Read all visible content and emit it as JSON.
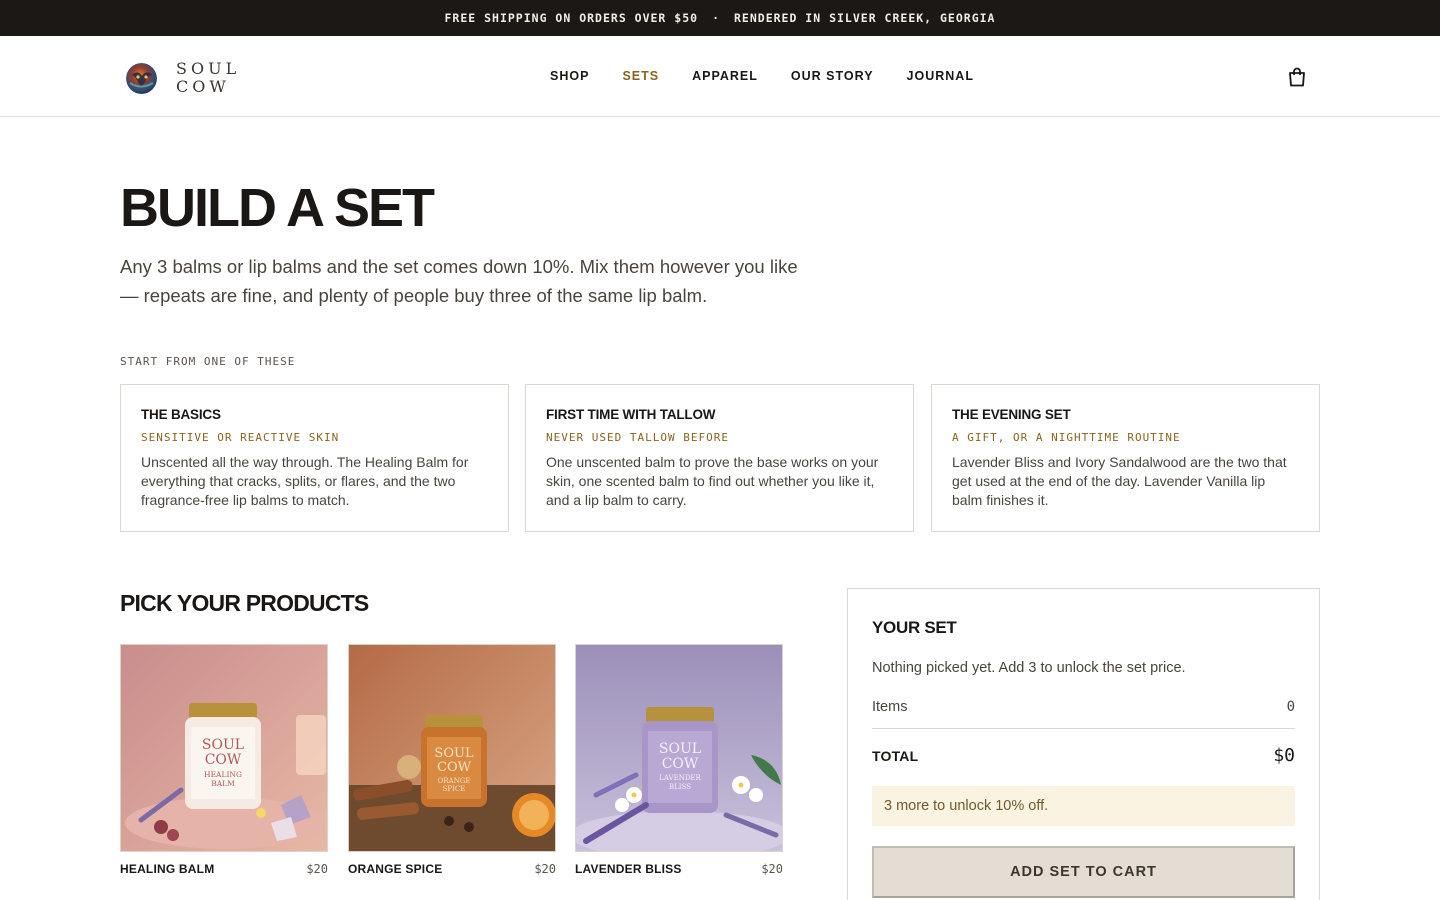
{
  "announcement": {
    "left": "FREE SHIPPING ON ORDERS OVER $50",
    "separator": "·",
    "right": "RENDERED IN SILVER CREEK, GEORGIA"
  },
  "brand": {
    "line1": "SOUL",
    "line2": "COW"
  },
  "nav": {
    "items": [
      "SHOP",
      "SETS",
      "APPAREL",
      "OUR STORY",
      "JOURNAL"
    ],
    "active": "SETS"
  },
  "icons": {
    "cart": "shopping-bag-icon",
    "logo": "soul-cow-logo"
  },
  "hero": {
    "title": "BUILD A SET",
    "subtitle": "Any 3 balms or lip balms and the set comes down 10%. Mix them however you like — repeats are fine, and plenty of people buy three of the same lip balm."
  },
  "starters": {
    "kicker": "START FROM ONE OF THESE",
    "cards": [
      {
        "title": "THE BASICS",
        "tag": "SENSITIVE OR REACTIVE SKIN",
        "body": "Unscented all the way through. The Healing Balm for everything that cracks, splits, or flares, and the two fragrance-free lip balms to match."
      },
      {
        "title": "FIRST TIME WITH TALLOW",
        "tag": "NEVER USED TALLOW BEFORE",
        "body": "One unscented balm to prove the base works on your skin, one scented balm to find out whether you like it, and a lip balm to carry."
      },
      {
        "title": "THE EVENING SET",
        "tag": "A GIFT, OR A NIGHTTIME ROUTINE",
        "body": "Lavender Bliss and Ivory Sandalwood are the two that get used at the end of the day. Lavender Vanilla lip balm finishes it."
      }
    ]
  },
  "products": {
    "title": "PICK YOUR PRODUCTS",
    "items": [
      {
        "name": "HEALING BALM",
        "price": "$20",
        "jar_label": [
          "SOUL",
          "COW",
          "HEALING",
          "BALM"
        ],
        "accent": "#d9a79c"
      },
      {
        "name": "ORANGE SPICE",
        "price": "$20",
        "jar_label": [
          "SOUL",
          "COW",
          "ORANGE",
          "SPICE"
        ],
        "accent": "#c9825a"
      },
      {
        "name": "LAVENDER BLISS",
        "price": "$20",
        "jar_label": [
          "SOUL",
          "COW",
          "LAVENDER",
          "BLISS"
        ],
        "accent": "#a99bc6"
      }
    ]
  },
  "set": {
    "title": "YOUR SET",
    "empty_message": "Nothing picked yet. Add 3 to unlock the set price.",
    "items_label": "Items",
    "items_value": "0",
    "total_label": "TOTAL",
    "total_value": "$0",
    "notice": "3 more to unlock 10% off.",
    "button": "ADD SET TO CART"
  },
  "colors": {
    "topbar": "#1c1815",
    "accent": "#8a6420",
    "notice_bg": "#faf3e2",
    "button_disabled": "#e3ddd3"
  }
}
